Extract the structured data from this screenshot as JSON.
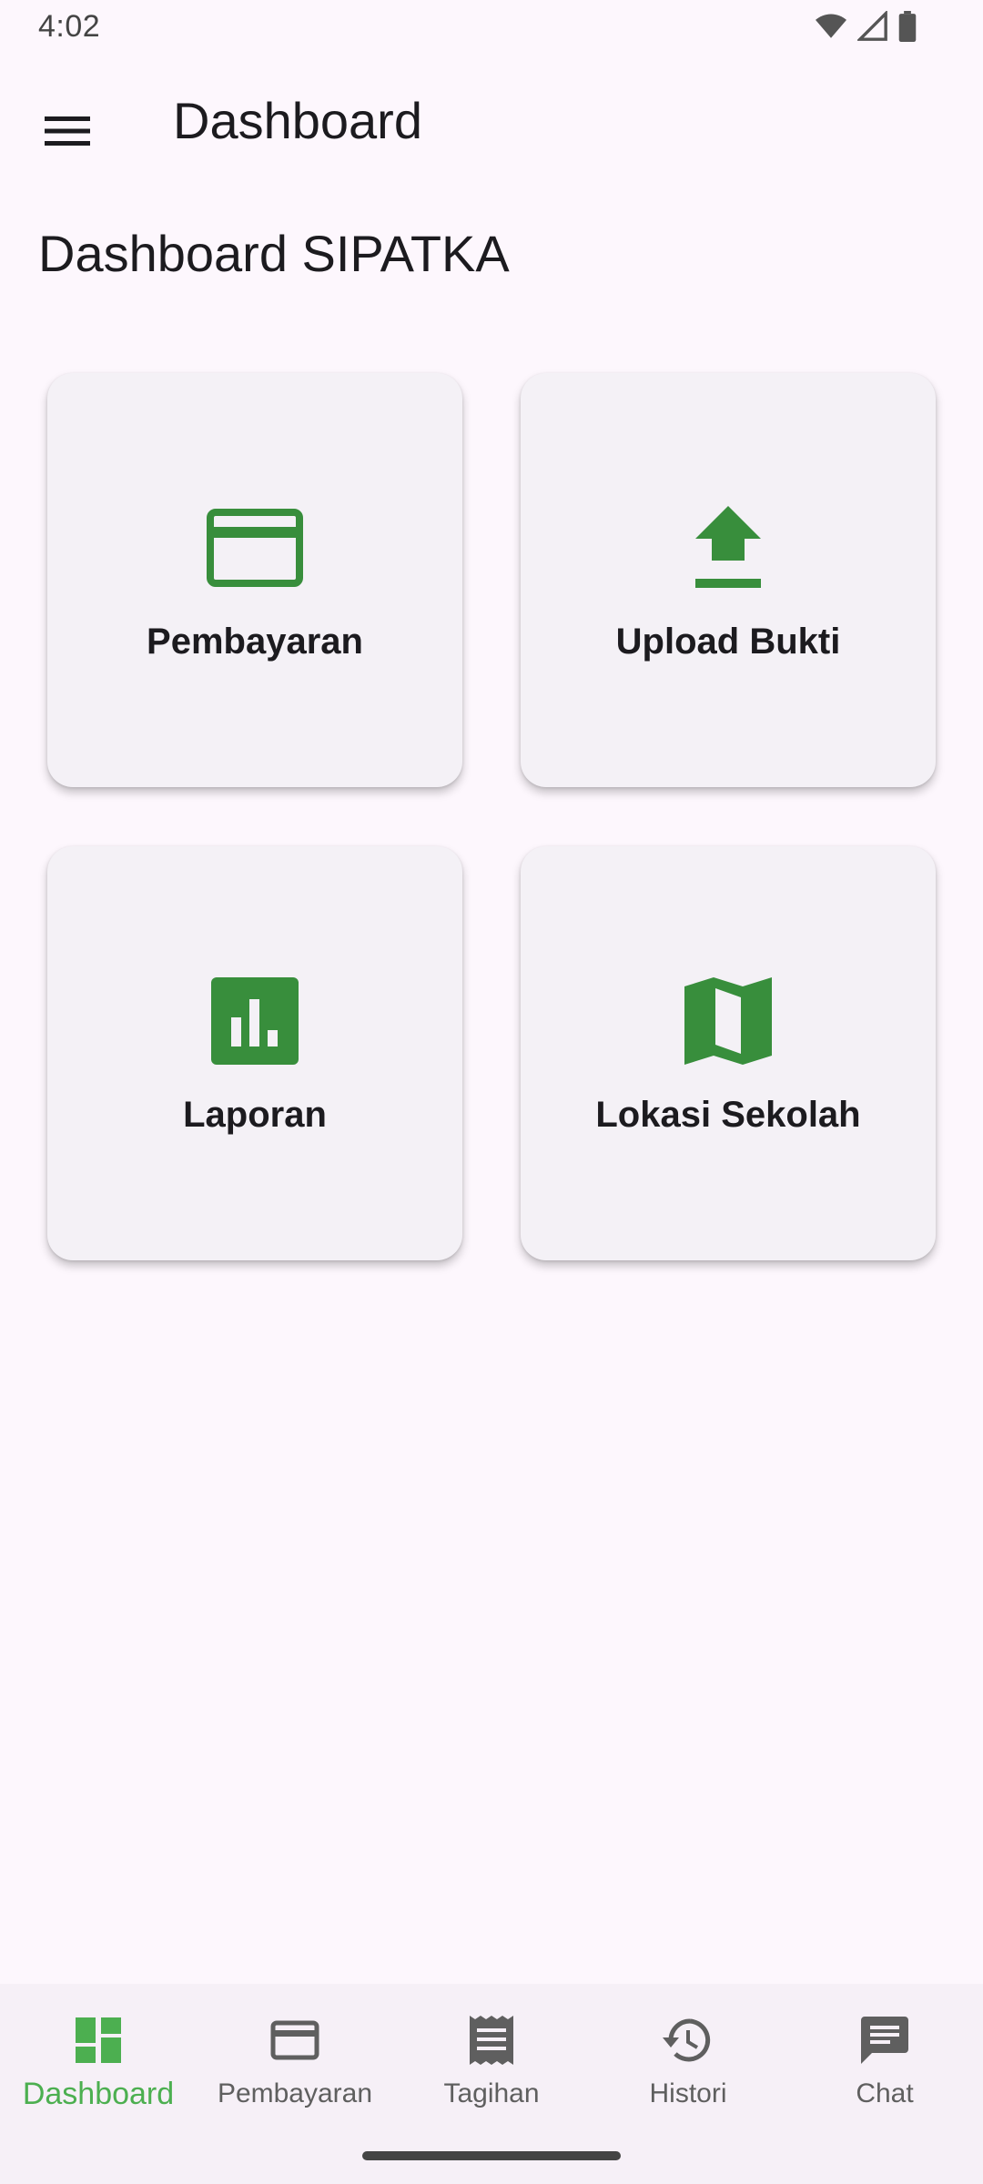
{
  "status_bar": {
    "time": "4:02"
  },
  "app_bar": {
    "title": "Dashboard"
  },
  "page": {
    "heading": "Dashboard SIPATKA"
  },
  "cards": [
    {
      "label": "Pembayaran",
      "icon": "credit-card-icon"
    },
    {
      "label": "Upload Bukti",
      "icon": "upload-icon"
    },
    {
      "label": "Laporan",
      "icon": "bar-chart-icon"
    },
    {
      "label": "Lokasi Sekolah",
      "icon": "map-icon"
    }
  ],
  "bottom_nav": {
    "items": [
      {
        "label": "Dashboard",
        "icon": "dashboard-icon",
        "active": true
      },
      {
        "label": "Pembayaran",
        "icon": "credit-card-icon"
      },
      {
        "label": "Tagihan",
        "icon": "receipt-icon"
      },
      {
        "label": "Histori",
        "icon": "history-icon"
      },
      {
        "label": "Chat",
        "icon": "chat-icon"
      }
    ]
  },
  "colors": {
    "accent": "#388e3c",
    "active_nav": "#4caf50",
    "background": "#fdf7fd",
    "card": "#f4f1f6"
  }
}
